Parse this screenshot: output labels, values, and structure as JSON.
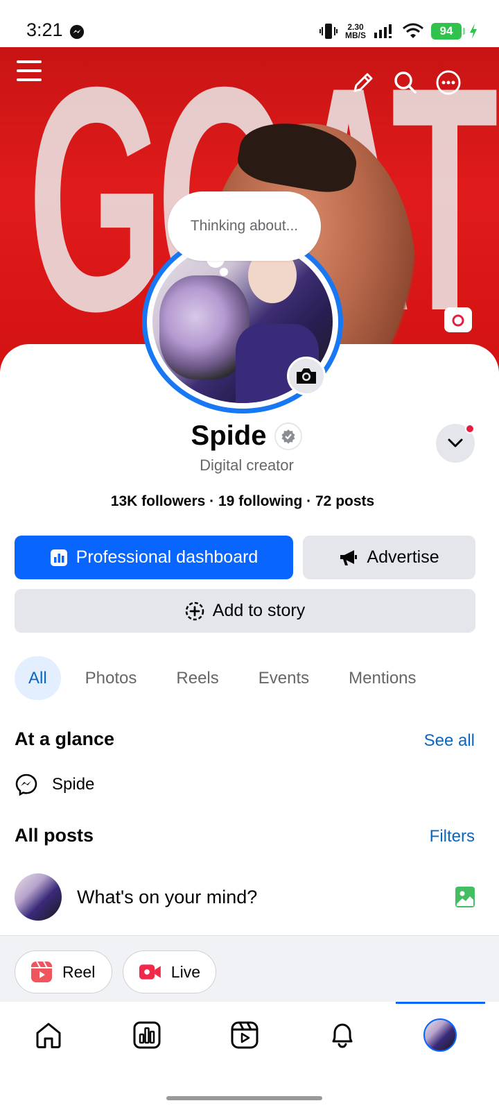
{
  "status_bar": {
    "time": "3:21",
    "network_speed_value": "2.30",
    "network_speed_unit": "MB/S",
    "battery": "94"
  },
  "profile": {
    "thought_placeholder": "Thinking about...",
    "name": "Spide",
    "subtitle": "Digital creator",
    "stats": "13K followers · 19 following · 72 posts"
  },
  "buttons": {
    "professional_dashboard": "Professional dashboard",
    "advertise": "Advertise",
    "add_to_story": "Add to story"
  },
  "tabs": [
    "All",
    "Photos",
    "Reels",
    "Events",
    "Mentions"
  ],
  "at_a_glance": {
    "title": "At a glance",
    "link": "See all",
    "messenger_name": "Spide"
  },
  "all_posts": {
    "title": "All posts",
    "link": "Filters",
    "composer_placeholder": "What's on your mind?"
  },
  "quick_actions": {
    "reel": "Reel",
    "live": "Live"
  },
  "colors": {
    "accent": "#0866ff",
    "link": "#0a66c2",
    "cover": "#d31212"
  }
}
